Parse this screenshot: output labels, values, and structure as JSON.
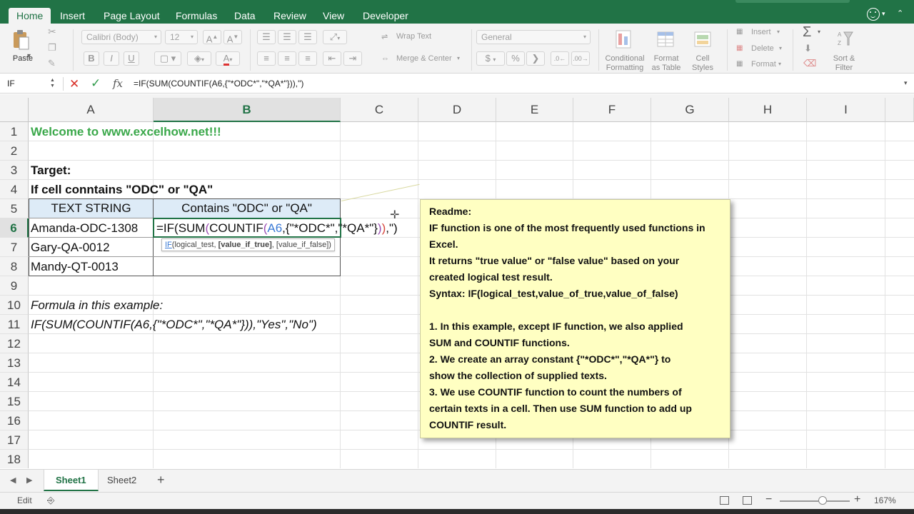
{
  "ribbon_tabs": [
    "Home",
    "Insert",
    "Page Layout",
    "Formulas",
    "Data",
    "Review",
    "View",
    "Developer"
  ],
  "ribbon": {
    "paste_label": "Paste",
    "font_name": "Calibri (Body)",
    "font_size": "12",
    "bold_label": "B",
    "italic_label": "I",
    "underline_label": "U",
    "wrap_text_label": "Wrap Text",
    "merge_center_label": "Merge & Center",
    "number_format": "General",
    "currency_label": "$",
    "percent_label": "%",
    "comma_label": "❯",
    "conditional_formatting_line1": "Conditional",
    "conditional_formatting_line2": "Formatting",
    "format_as_table_line1": "Format",
    "format_as_table_line2": "as Table",
    "cell_styles_line1": "Cell",
    "cell_styles_line2": "Styles",
    "insert_label": "Insert",
    "delete_label": "Delete",
    "format_label": "Format",
    "sort_filter_line1": "Sort &",
    "sort_filter_line2": "Filter"
  },
  "formula_bar": {
    "name_box": "IF",
    "formula": "=IF(SUM(COUNTIF(A6,{\"*ODC*\",\"*QA*\"})),\")"
  },
  "columns": [
    "A",
    "B",
    "C",
    "D",
    "E",
    "F",
    "G",
    "H",
    "I"
  ],
  "rows": [
    "1",
    "2",
    "3",
    "4",
    "5",
    "6",
    "7",
    "8",
    "9",
    "10",
    "11",
    "12",
    "13",
    "14",
    "15",
    "16",
    "17",
    "18"
  ],
  "cells": {
    "a1": "Welcome to www.excelhow.net!!!",
    "a3": "Target:",
    "a4": "If cell conntains \"ODC\" or \"QA\"",
    "a5": "TEXT STRING",
    "b5": "Contains \"ODC\" or \"QA\"",
    "a6": "Amanda-ODC-1308",
    "a7": "Gary-QA-0012",
    "a8": "Mandy-QT-0013",
    "a10": "Formula in this example:",
    "a11": "IF(SUM(COUNTIF(A6,{\"*ODC*\",\"*QA*\"})),\"Yes\",\"No\")"
  },
  "edit": {
    "p1": "=IF(SUM",
    "p2": "(",
    "p3": "COUNTIF",
    "p4": "(",
    "p5": "A6",
    "p6": ",{\"*ODC*\",\"*QA*\"}",
    "p7": ")",
    "p8": ")",
    "p9": ",\")"
  },
  "tooltip": {
    "fn": "IF",
    "arg1": "(logical_test, ",
    "arg2": "[value_if_true]",
    "arg3": ", [value_if_false])"
  },
  "note": {
    "lines": [
      "Readme:",
      "IF function is one of the most frequently used functions in",
      "Excel.",
      "It returns \"true value\" or \"false value\" based on your",
      "created logical test result.",
      "Syntax: IF(logical_test,value_of_true,value_of_false)",
      "",
      "1. In this example, except IF function, we also applied",
      "SUM and COUNTIF functions.",
      "2. We create an array constant {\"*ODC*\",\"*QA*\"} to",
      "show the collection of supplied texts.",
      "3. We use COUNTIF function to count the numbers of",
      "certain texts in a cell. Then use SUM function to add up",
      "COUNTIF result."
    ]
  },
  "sheets": [
    "Sheet1",
    "Sheet2"
  ],
  "status": {
    "mode": "Edit",
    "zoom": "167%"
  },
  "colors": {
    "accent": "#217346",
    "welcome_green": "#3aa84a",
    "note_bg": "#ffffc2",
    "header_fill": "#ddebf7"
  }
}
